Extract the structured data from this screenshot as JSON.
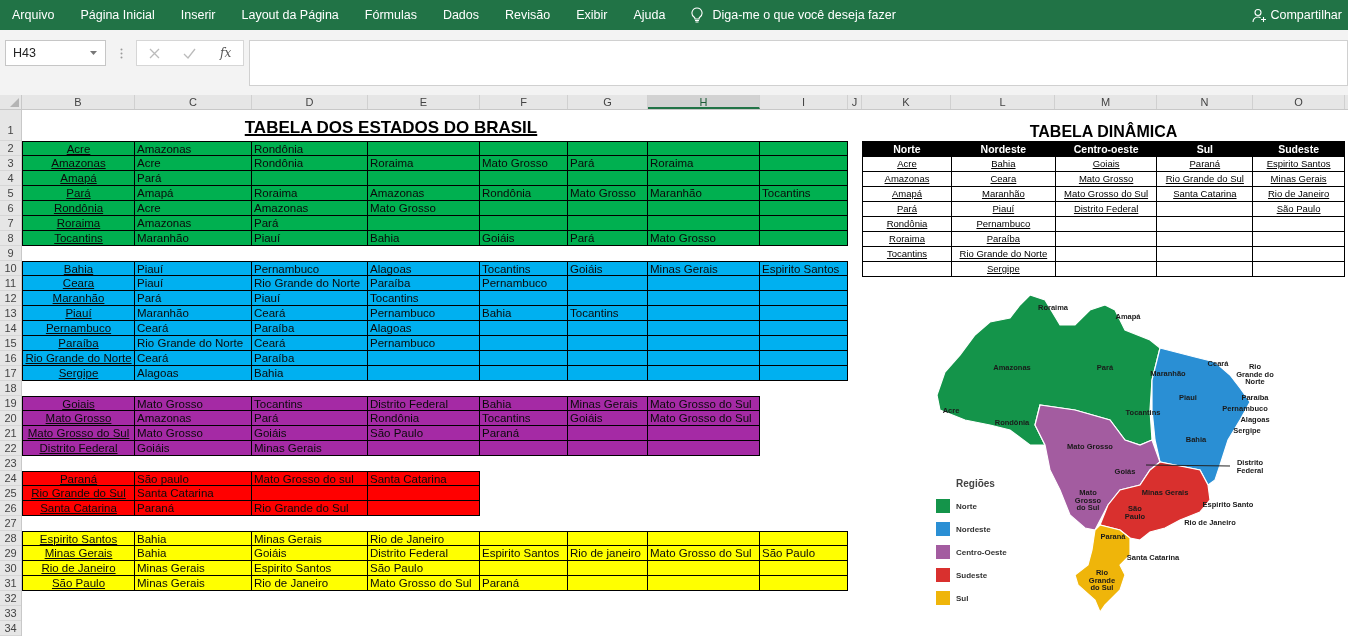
{
  "ribbon": {
    "tabs": [
      "Arquivo",
      "Página Inicial",
      "Inserir",
      "Layout da Página",
      "Fórmulas",
      "Dados",
      "Revisão",
      "Exibir",
      "Ajuda"
    ],
    "tell_me": "Diga-me o que você deseja fazer",
    "share": "Compartilhar"
  },
  "formula_bar": {
    "name_box": "H43",
    "function_button": "fx"
  },
  "columns": [
    {
      "label": "B",
      "selected": false
    },
    {
      "label": "C",
      "selected": false
    },
    {
      "label": "D",
      "selected": false
    },
    {
      "label": "E",
      "selected": false
    },
    {
      "label": "F",
      "selected": false
    },
    {
      "label": "G",
      "selected": false
    },
    {
      "label": "H",
      "selected": true
    },
    {
      "label": "I",
      "selected": false
    },
    {
      "label": "J",
      "selected": false
    },
    {
      "label": "K",
      "selected": false
    },
    {
      "label": "L",
      "selected": false
    },
    {
      "label": "M",
      "selected": false
    },
    {
      "label": "N",
      "selected": false
    },
    {
      "label": "O",
      "selected": false
    }
  ],
  "row_numbers": [
    "1",
    "2",
    "3",
    "4",
    "5",
    "6",
    "7",
    "8",
    "9",
    "10",
    "11",
    "12",
    "13",
    "14",
    "15",
    "16",
    "17",
    "18",
    "19",
    "20",
    "21",
    "22",
    "23",
    "24",
    "25",
    "26",
    "27",
    "28",
    "29",
    "30",
    "31",
    "32",
    "33",
    "34"
  ],
  "states_table": {
    "title": "TABELA DOS ESTADOS DO BRASIL",
    "groups": [
      {
        "color": "#00b050",
        "rows": [
          {
            "state": "Acre",
            "neighbors": [
              "Amazonas",
              "Rondônia"
            ]
          },
          {
            "state": "Amazonas",
            "neighbors": [
              "Acre",
              "Rondônia",
              "Roraima",
              "Mato Grosso",
              "Pará",
              "Roraima"
            ]
          },
          {
            "state": "Amapá",
            "neighbors": [
              "Pará"
            ]
          },
          {
            "state": "Pará",
            "neighbors": [
              "Amapá",
              "Roraima",
              "Amazonas",
              "Rondônia",
              "Mato Grosso",
              "Maranhão",
              "Tocantins"
            ]
          },
          {
            "state": "Rondônia",
            "neighbors": [
              "Acre",
              "Amazonas",
              "Mato Grosso"
            ]
          },
          {
            "state": "Roraima",
            "neighbors": [
              "Amazonas",
              "Pará"
            ]
          },
          {
            "state": "Tocantins",
            "neighbors": [
              "Maranhão",
              "Piauí",
              "Bahia",
              "Goiáis",
              "Pará",
              "Mato Grosso"
            ]
          }
        ]
      },
      {
        "color": "#00b0f0",
        "rows": [
          {
            "state": "Bahia",
            "neighbors": [
              "Piauí",
              "Pernambuco",
              "Alagoas",
              "Tocantins",
              "Goiáis",
              "Minas Gerais",
              "Espirito Santos"
            ]
          },
          {
            "state": "Ceara",
            "neighbors": [
              "Piauí",
              "Rio Grande do Norte",
              "Paraíba",
              "Pernambuco"
            ]
          },
          {
            "state": "Maranhão",
            "neighbors": [
              "Pará",
              "Piauí",
              "Tocantins"
            ]
          },
          {
            "state": "Piauí",
            "neighbors": [
              "Maranhão",
              "Ceará",
              "Pernambuco",
              "Bahia",
              "Tocantins"
            ]
          },
          {
            "state": "Pernambuco",
            "neighbors": [
              "Ceará",
              "Paraíba",
              "Alagoas"
            ]
          },
          {
            "state": "Paraíba",
            "neighbors": [
              "Rio Grande do Norte",
              "Ceará",
              "Pernambuco"
            ]
          },
          {
            "state": "Rio Grande do Norte",
            "neighbors": [
              "Ceará",
              "Paraíba"
            ]
          },
          {
            "state": "Sergipe",
            "neighbors": [
              "Alagoas",
              "Bahia"
            ]
          }
        ]
      },
      {
        "color": "#a52aa5",
        "rows": [
          {
            "state": "Goiais",
            "neighbors": [
              "Mato Grosso",
              "Tocantins",
              "Distrito Federal",
              "Bahia",
              "Minas Gerais",
              "Mato Grosso do Sul"
            ]
          },
          {
            "state": "Mato Grosso",
            "neighbors": [
              "Amazonas",
              "Pará",
              "Rondônia",
              "Tocantins",
              "Goiáis",
              "Mato Grosso do Sul"
            ]
          },
          {
            "state": "Mato Grosso do Sul",
            "neighbors": [
              "Mato Grosso",
              "Goiáis",
              "São Paulo",
              "Paraná"
            ]
          },
          {
            "state": "Distrito Federal",
            "neighbors": [
              "Goiáis",
              "Minas Gerais"
            ]
          }
        ]
      },
      {
        "color": "#ff0000",
        "rows": [
          {
            "state": "Paraná",
            "neighbors": [
              "São paulo",
              "Mato Grosso do sul",
              "Santa Catarina"
            ]
          },
          {
            "state": "Rio Grande do Sul",
            "neighbors": [
              "Santa Catarina"
            ]
          },
          {
            "state": "Santa Catarina",
            "neighbors": [
              "Paraná",
              "Rio Grande do Sul"
            ]
          }
        ]
      },
      {
        "color": "#ffff00",
        "rows": [
          {
            "state": "Espirito Santos",
            "neighbors": [
              "Bahia",
              "Minas Gerais",
              "Rio de Janeiro"
            ]
          },
          {
            "state": "Minas Gerais",
            "neighbors": [
              "Bahia",
              "Goiáis",
              "Distrito Federal",
              "Espirito Santos",
              "Rio de janeiro",
              "Mato Grosso do Sul",
              "São Paulo"
            ]
          },
          {
            "state": "Rio de Janeiro",
            "neighbors": [
              "Minas Gerais",
              "Espirito Santos",
              "São Paulo"
            ]
          },
          {
            "state": "São Paulo",
            "neighbors": [
              "Minas Gerais",
              "Rio de Janeiro",
              "Mato Grosso do Sul",
              "Paraná"
            ]
          }
        ]
      }
    ]
  },
  "pivot_table": {
    "title": "TABELA DINÂMICA",
    "columns": [
      {
        "header": "Norte",
        "items": [
          "Acre",
          "Amazonas",
          "Amapá",
          "Pará",
          "Rondônia",
          "Roraima",
          "Tocantins"
        ]
      },
      {
        "header": "Nordeste",
        "items": [
          "Bahia",
          "Ceara",
          "Maranhão",
          "Piauí",
          "Pernambuco",
          "Paraíba",
          "Rio Grande do Norte",
          "Sergipe"
        ]
      },
      {
        "header": "Centro-oeste",
        "items": [
          "Goiais",
          "Mato Grosso",
          "Mato Grosso do Sul",
          "Distrito Federal"
        ]
      },
      {
        "header": "Sul",
        "items": [
          "Paraná",
          "Rio Grande do Sul",
          "Santa Catarina"
        ]
      },
      {
        "header": "Sudeste",
        "items": [
          "Espirito Santos",
          "Minas Gerais",
          "Rio de Janeiro",
          "São Paulo"
        ]
      }
    ]
  },
  "map": {
    "labels": [
      "Roraima",
      "Amapá",
      "Amazonas",
      "Pará",
      "Maranhão",
      "Ceará",
      "Rio Grande do Norte",
      "Piaui",
      "Paraíba",
      "Pernambuco",
      "Alagoas",
      "Sergipe",
      "Acre",
      "Rondônia",
      "Tocantins",
      "Bahia",
      "Mato Grosso",
      "Goiás",
      "Distrito Federal",
      "Mato Grosso do Sul",
      "Minas Gerais",
      "Espirito Santo",
      "São Paulo",
      "Rio de Janeiro",
      "Paraná",
      "Santa Catarina",
      "Rio Grande do Sul"
    ],
    "legend_title": "Regiões",
    "legend": [
      {
        "label": "Norte",
        "color": "#14944a"
      },
      {
        "label": "Nordeste",
        "color": "#2a8fd4"
      },
      {
        "label": "Centro-Oeste",
        "color": "#a35ca0"
      },
      {
        "label": "Sudeste",
        "color": "#d9302e"
      },
      {
        "label": "Sul",
        "color": "#efb50a"
      }
    ]
  }
}
